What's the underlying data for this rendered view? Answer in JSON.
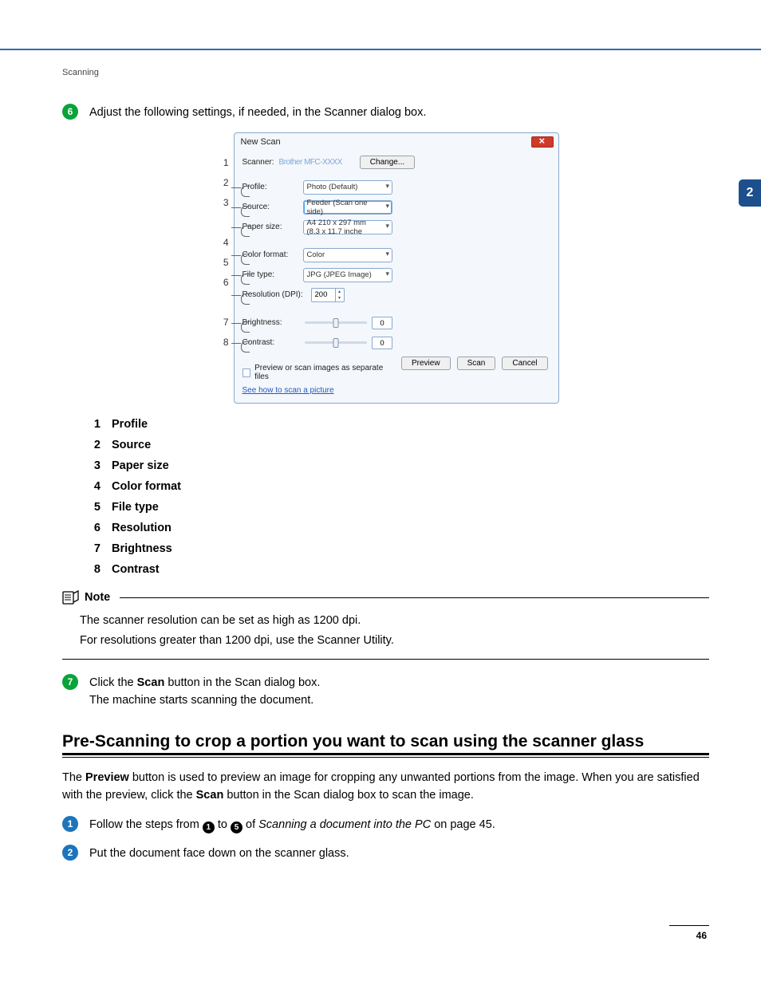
{
  "header": {
    "section": "Scanning"
  },
  "side_tab": "2",
  "page_number": "46",
  "step6": {
    "num": "6",
    "text": "Adjust the following settings, if needed, in the Scanner dialog box."
  },
  "dialog": {
    "title": "New Scan",
    "scanner_label": "Scanner:",
    "scanner_value": "Brother MFC-XXXX",
    "change_btn": "Change...",
    "rows": {
      "profile": {
        "label": "Profile:",
        "value": "Photo (Default)"
      },
      "source": {
        "label": "Source:",
        "value": "Feeder (Scan one side)"
      },
      "paper": {
        "label": "Paper size:",
        "value": "A4 210 x 297 mm (8.3 x 11.7 inche"
      },
      "color": {
        "label": "Color format:",
        "value": "Color"
      },
      "file": {
        "label": "File type:",
        "value": "JPG (JPEG Image)"
      },
      "res": {
        "label": "Resolution (DPI):",
        "value": "200"
      },
      "bright": {
        "label": "Brightness:",
        "value": "0"
      },
      "contrast": {
        "label": "Contrast:",
        "value": "0"
      }
    },
    "checkbox": "Preview or scan images as separate files",
    "link": "See how to scan a picture",
    "buttons": {
      "preview": "Preview",
      "scan": "Scan",
      "cancel": "Cancel"
    }
  },
  "callouts": [
    "1",
    "2",
    "3",
    "4",
    "5",
    "6",
    "7",
    "8"
  ],
  "definitions": [
    {
      "n": "1",
      "t": "Profile"
    },
    {
      "n": "2",
      "t": "Source"
    },
    {
      "n": "3",
      "t": "Paper size"
    },
    {
      "n": "4",
      "t": "Color format"
    },
    {
      "n": "5",
      "t": "File type"
    },
    {
      "n": "6",
      "t": "Resolution"
    },
    {
      "n": "7",
      "t": "Brightness"
    },
    {
      "n": "8",
      "t": "Contrast"
    }
  ],
  "note": {
    "title": "Note",
    "line1": "The scanner resolution can be set as high as 1200 dpi.",
    "line2": "For resolutions greater than 1200 dpi, use the Scanner Utility."
  },
  "step7": {
    "num": "7",
    "line1_a": "Click the ",
    "line1_b": "Scan",
    "line1_c": " button in the Scan dialog box.",
    "line2": "The machine starts scanning the document."
  },
  "h2": "Pre-Scanning to crop a portion you want to scan using the scanner glass",
  "para": {
    "a": "The ",
    "b": "Preview",
    "c": " button is used to preview an image for cropping any unwanted portions from the image. When you are satisfied with the preview, click the ",
    "d": "Scan",
    "e": " button in the Scan dialog box to scan the image."
  },
  "stepA": {
    "num": "1",
    "a": "Follow the steps from ",
    "ref1": "1",
    "b": " to ",
    "ref2": "5",
    "c": " of ",
    "ital": "Scanning a document into the PC",
    "d": " on page 45."
  },
  "stepB": {
    "num": "2",
    "text": "Put the document face down on the scanner glass."
  }
}
